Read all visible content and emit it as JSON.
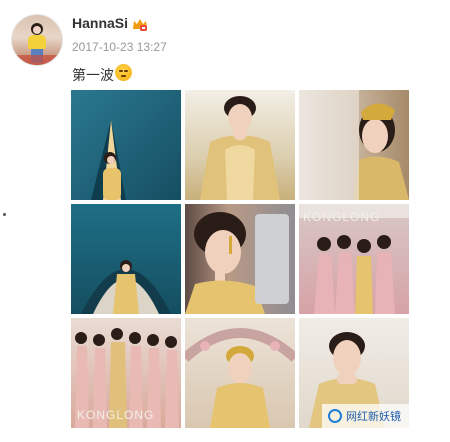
{
  "post": {
    "username": "HannaSi",
    "timestamp": "2017-10-23 13:27",
    "text": "第一波",
    "emoji": "sleepy-face-emoji"
  },
  "badge": {
    "icon": "vip-crown-icon",
    "color": "#f39c12"
  },
  "photos": [
    {
      "name": "photo-1",
      "scene": "teal wall with tent opening",
      "dominant": "#1f5f75"
    },
    {
      "name": "photo-2",
      "scene": "gold embroidered dress, hands at chin",
      "dominant": "#d9c89a"
    },
    {
      "name": "photo-3",
      "scene": "veiled bride with gold headpiece",
      "dominant": "#c9b9a2"
    },
    {
      "name": "photo-4",
      "scene": "bride seated under teal arch",
      "dominant": "#1d6276"
    },
    {
      "name": "photo-5",
      "scene": "close-up profile with earrings",
      "dominant": "#b89a86"
    },
    {
      "name": "photo-6",
      "scene": "bridesmaids in pink dresses",
      "dominant": "#d9a9ac"
    },
    {
      "name": "photo-7",
      "scene": "bride with bridesmaids in blush gowns",
      "dominant": "#e6b9a8"
    },
    {
      "name": "photo-8",
      "scene": "bride under floral arch",
      "dominant": "#e4d6c6"
    },
    {
      "name": "photo-9",
      "scene": "smiling bride in gold embroidered dress",
      "dominant": "#e9e4dc"
    }
  ],
  "photo_text": {
    "kong_long_1": "KONGLONG",
    "kong_long_2": "KONGLONG"
  },
  "watermark": {
    "text": "网红新妖镜",
    "icon": "wechat-channel-icon",
    "color": "#1f7fd6"
  }
}
